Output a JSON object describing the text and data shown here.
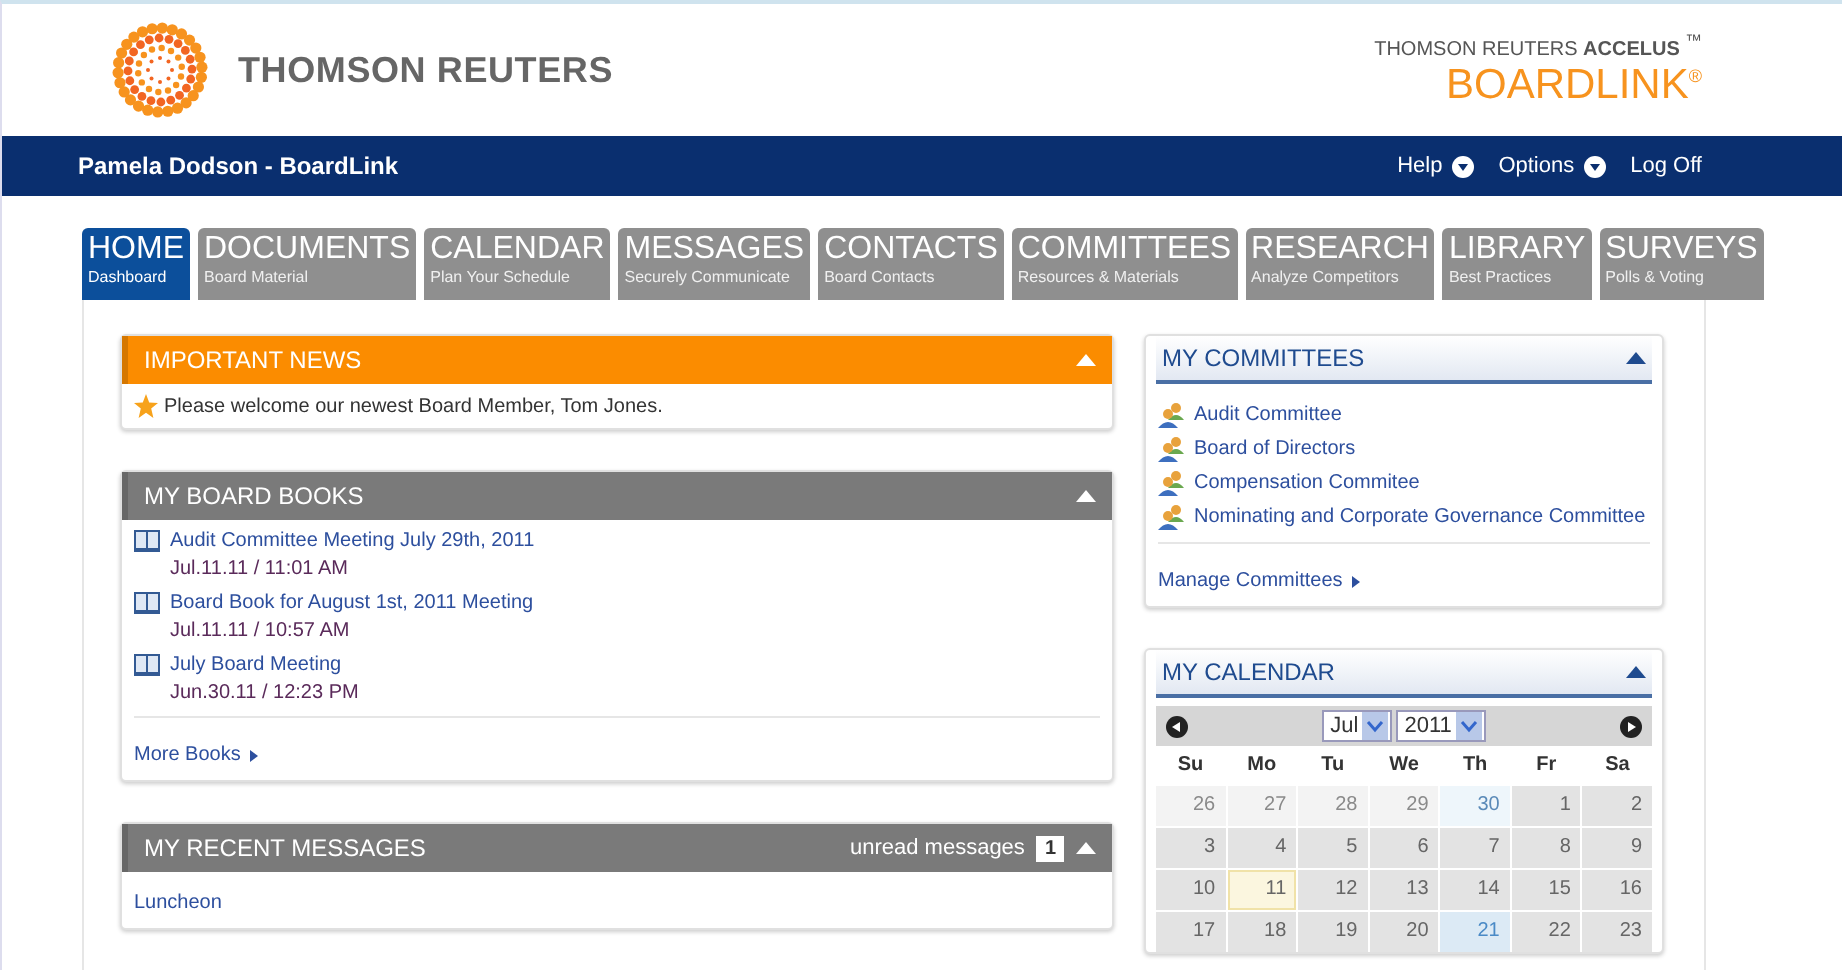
{
  "header": {
    "brand": "THOMSON REUTERS",
    "product_line": "THOMSON REUTERS",
    "product_line_bold": "ACCELUS",
    "trademark": "™",
    "product": "BOARDLINK",
    "registered": "®"
  },
  "nav_bar": {
    "user": "Pamela Dodson - BoardLink",
    "links": [
      {
        "label": "Help",
        "menu": true
      },
      {
        "label": "Options",
        "menu": true
      },
      {
        "label": "Log Off",
        "menu": false
      }
    ]
  },
  "tabs": [
    {
      "label": "HOME",
      "sub": "Dashboard",
      "selected": true
    },
    {
      "label": "DOCUMENTS",
      "sub": "Board Material",
      "selected": false
    },
    {
      "label": "CALENDAR",
      "sub": "Plan Your Schedule",
      "selected": false
    },
    {
      "label": "MESSAGES",
      "sub": "Securely Communicate",
      "selected": false
    },
    {
      "label": "CONTACTS",
      "sub": "Board Contacts",
      "selected": false
    },
    {
      "label": "COMMITTEES",
      "sub": "Resources & Materials",
      "selected": false
    },
    {
      "label": "RESEARCH",
      "sub": "Analyze Competitors",
      "selected": false
    },
    {
      "label": "LIBRARY",
      "sub": "Best Practices",
      "selected": false
    },
    {
      "label": "SURVEYS",
      "sub": "Polls & Voting",
      "selected": false
    }
  ],
  "important_news": {
    "title": "IMPORTANT NEWS",
    "items": [
      "Please welcome our newest Board Member, Tom Jones."
    ]
  },
  "board_books": {
    "title": "MY BOARD BOOKS",
    "items": [
      {
        "title": "Audit Committee Meeting July 29th, 2011",
        "date": "Jul.11.11 / 11:01 AM"
      },
      {
        "title": "Board Book for August 1st, 2011 Meeting",
        "date": "Jul.11.11 / 10:57 AM"
      },
      {
        "title": "July Board Meeting",
        "date": "Jun.30.11 / 12:23 PM"
      }
    ],
    "more": "More Books"
  },
  "recent_messages": {
    "title": "MY RECENT MESSAGES",
    "unread_label": "unread messages",
    "unread_count": "1",
    "items": [
      "Luncheon"
    ]
  },
  "committees": {
    "title": "MY COMMITTEES",
    "items": [
      "Audit Committee",
      "Board of Directors",
      "Compensation Commitee",
      "Nominating and Corporate Governance Committee"
    ],
    "manage": "Manage Committees"
  },
  "calendar": {
    "title": "MY CALENDAR",
    "month": "Jul",
    "year": "2011",
    "weekdays": [
      "Su",
      "Mo",
      "Tu",
      "We",
      "Th",
      "Fr",
      "Sa"
    ],
    "days": [
      {
        "label": "26",
        "kind": "other"
      },
      {
        "label": "27",
        "kind": "other"
      },
      {
        "label": "28",
        "kind": "other"
      },
      {
        "label": "29",
        "kind": "other"
      },
      {
        "label": "30",
        "kind": "other-marked"
      },
      {
        "label": "1",
        "kind": "day"
      },
      {
        "label": "2",
        "kind": "day"
      },
      {
        "label": "3",
        "kind": "day"
      },
      {
        "label": "4",
        "kind": "day"
      },
      {
        "label": "5",
        "kind": "day"
      },
      {
        "label": "6",
        "kind": "day"
      },
      {
        "label": "7",
        "kind": "day"
      },
      {
        "label": "8",
        "kind": "day"
      },
      {
        "label": "9",
        "kind": "day"
      },
      {
        "label": "10",
        "kind": "day"
      },
      {
        "label": "11",
        "kind": "today"
      },
      {
        "label": "12",
        "kind": "day"
      },
      {
        "label": "13",
        "kind": "day"
      },
      {
        "label": "14",
        "kind": "day"
      },
      {
        "label": "15",
        "kind": "day"
      },
      {
        "label": "16",
        "kind": "day"
      },
      {
        "label": "17",
        "kind": "day"
      },
      {
        "label": "18",
        "kind": "day"
      },
      {
        "label": "19",
        "kind": "day"
      },
      {
        "label": "20",
        "kind": "day"
      },
      {
        "label": "21",
        "kind": "marked"
      },
      {
        "label": "22",
        "kind": "day"
      },
      {
        "label": "23",
        "kind": "day"
      }
    ]
  }
}
